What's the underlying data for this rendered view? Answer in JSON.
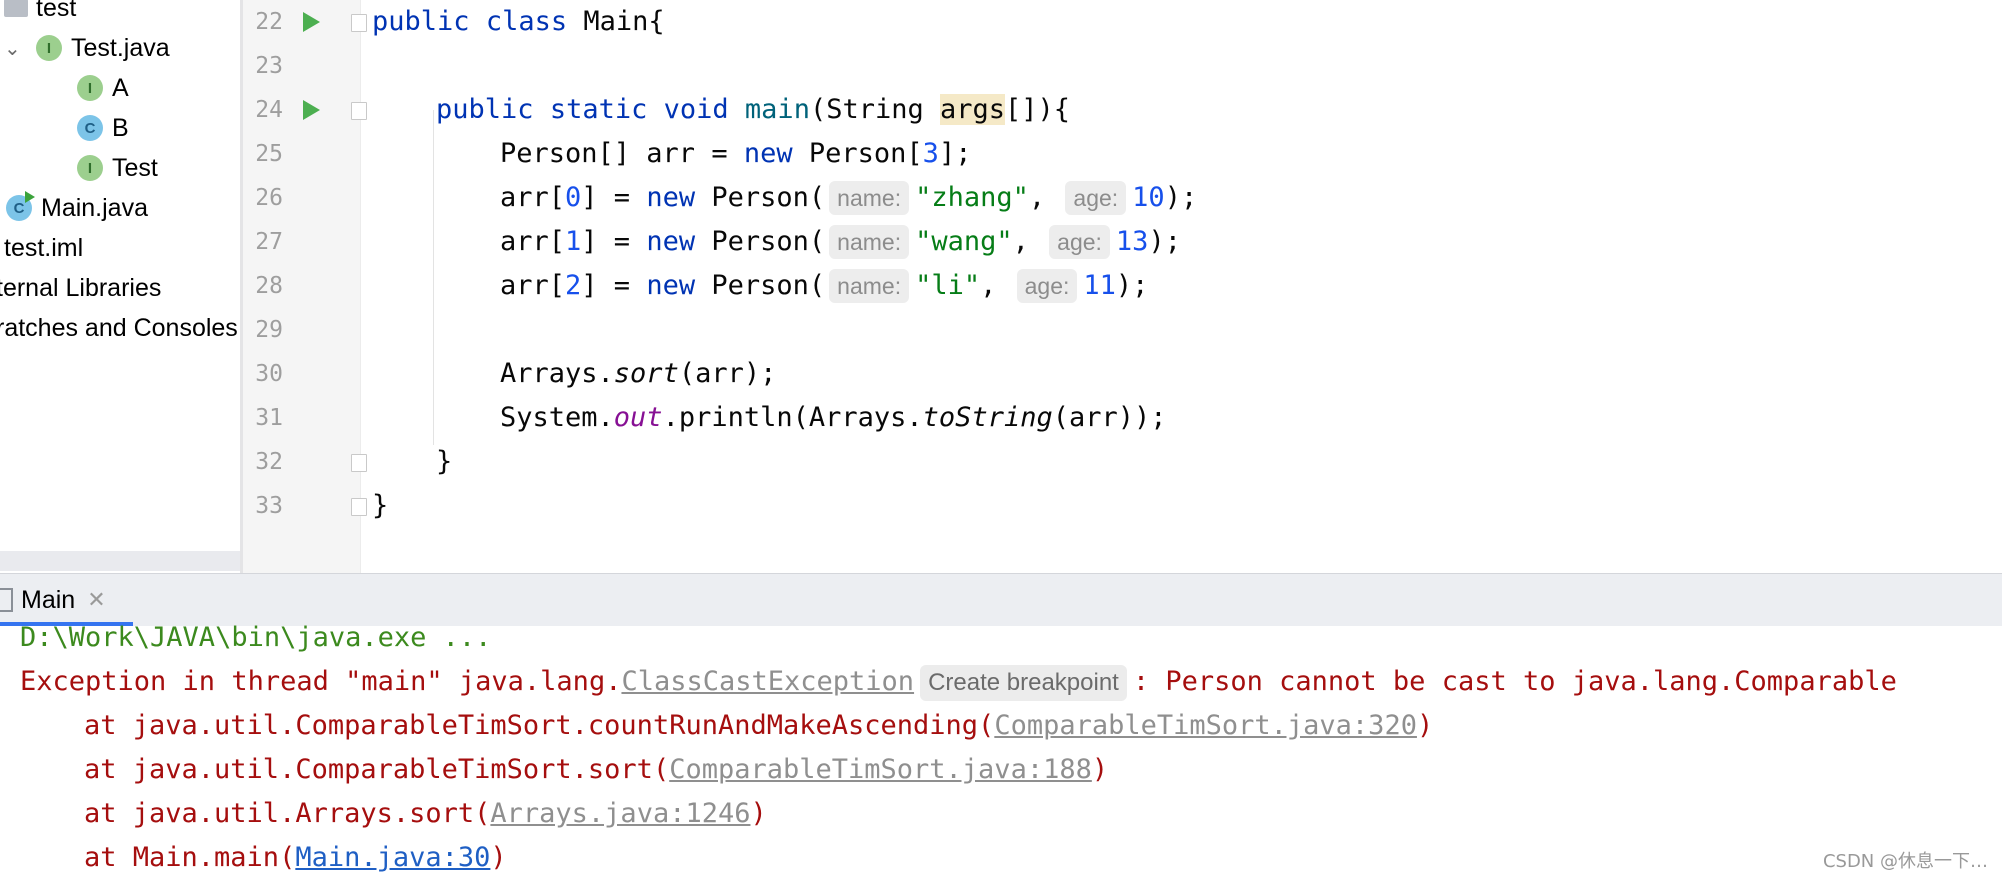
{
  "project_tree": {
    "items": [
      {
        "label": "test",
        "icon": "folder-icon"
      },
      {
        "label": "Test.java",
        "icon": "interface-icon",
        "badge": "I"
      },
      {
        "label": "A",
        "icon": "interface-icon",
        "badge": "I"
      },
      {
        "label": "B",
        "icon": "class-icon",
        "badge": "C"
      },
      {
        "label": "Test",
        "icon": "interface-icon",
        "badge": "I"
      },
      {
        "label": "Main.java",
        "icon": "runnable-class-icon",
        "badge": "C"
      },
      {
        "label": "test.iml",
        "icon": "module-file-icon"
      },
      {
        "label": "ternal Libraries",
        "icon": "libraries-icon"
      },
      {
        "label": "ratches and Consoles",
        "icon": "scratches-icon"
      }
    ]
  },
  "editor": {
    "line_numbers": [
      "22",
      "23",
      "24",
      "25",
      "26",
      "27",
      "28",
      "29",
      "30",
      "31",
      "32",
      "33"
    ],
    "code": {
      "l22": {
        "kw1": "public",
        "kw2": "class",
        "rest": " Main{"
      },
      "l24": {
        "kw1": "public",
        "kw2": "static",
        "kw3": "void",
        "method": "main",
        "mid": "(String ",
        "param": "args",
        "end": "[]){"
      },
      "l25": {
        "a": "Person[] arr = ",
        "kw": "new",
        "b": " Person[",
        "num": "3",
        "c": "];"
      },
      "l26": {
        "a": "arr[",
        "idx": "0",
        "b": "] = ",
        "kw": "new",
        "c": " Person(",
        "hint_name": "name:",
        "str": "\"zhang\"",
        "comma": ", ",
        "hint_age": "age:",
        "num": "10",
        "end": ");"
      },
      "l27": {
        "a": "arr[",
        "idx": "1",
        "b": "] = ",
        "kw": "new",
        "c": " Person(",
        "hint_name": "name:",
        "str": "\"wang\"",
        "comma": ", ",
        "hint_age": "age:",
        "num": "13",
        "end": ");"
      },
      "l28": {
        "a": "arr[",
        "idx": "2",
        "b": "] = ",
        "kw": "new",
        "c": " Person(",
        "hint_name": "name:",
        "str": "\"li\"",
        "comma": ", ",
        "hint_age": "age:",
        "num": "11",
        "end": ");"
      },
      "l30": {
        "a": "Arrays.",
        "method": "sort",
        "b": "(arr);"
      },
      "l31": {
        "a": "System.",
        "field": "out",
        "b": ".println(Arrays.",
        "method": "toString",
        "c": "(arr));"
      },
      "l32": "}",
      "l33": "}"
    }
  },
  "run_panel": {
    "tab_label": "Main",
    "close_glyph": "✕",
    "console": {
      "command": "D:\\Work\\JAVA\\bin\\java.exe ...",
      "exception_prefix": "Exception in thread \"main\" java.lang.",
      "exception_class": "ClassCastException",
      "breakpoint_chip": "Create breakpoint",
      "exception_suffix": ": Person cannot be cast to java.lang.Comparable",
      "stack": [
        {
          "text": "at java.util.ComparableTimSort.countRunAndMakeAscending(",
          "link": "ComparableTimSort.java:320",
          "end": ")"
        },
        {
          "text": "at java.util.ComparableTimSort.sort(",
          "link": "ComparableTimSort.java:188",
          "end": ")"
        },
        {
          "text": "at java.util.Arrays.sort(",
          "link": "Arrays.java:1246",
          "end": ")"
        },
        {
          "text": "at Main.main(",
          "link": "Main.java:30",
          "end": ")"
        }
      ]
    }
  },
  "watermark": "CSDN @休息一下…",
  "colors": {
    "keyword": "#0033b3",
    "number": "#1750eb",
    "string": "#067d17",
    "error": "#a50e0e",
    "accent": "#3574f0"
  }
}
